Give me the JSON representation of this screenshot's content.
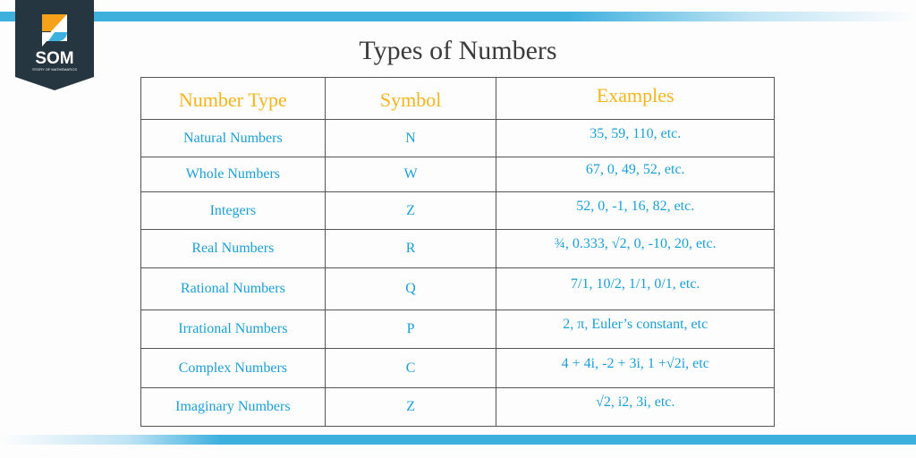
{
  "brand": {
    "logo_text": "SOM",
    "logo_subtext": "STORY OF MATHEMATICS"
  },
  "title": "Types of Numbers",
  "table": {
    "headers": [
      "Number Type",
      "Symbol",
      "Examples"
    ],
    "rows": [
      [
        "Natural Numbers",
        "N",
        "35, 59, 110, etc."
      ],
      [
        "Whole Numbers",
        "W",
        "67, 0, 49, 52, etc."
      ],
      [
        "Integers",
        "Z",
        "52, 0, -1, 16, 82, etc."
      ],
      [
        "Real Numbers",
        "R",
        "¾, 0.333, √2, 0, -10, 20, etc."
      ],
      [
        "Rational Numbers",
        "Q",
        "7/1, 10/2, 1/1, 0/1, etc."
      ],
      [
        "Irrational Numbers",
        "P",
        "2, π, Euler’s constant, etc"
      ],
      [
        "Complex Numbers",
        "C",
        "4 + 4i, -2 + 3i, 1 +√2i, etc"
      ],
      [
        "Imaginary Numbers",
        "Z",
        "√2, i2, 3i, etc."
      ]
    ]
  },
  "colors": {
    "header": "#f5b51a",
    "cell": "#1a9fd8",
    "accent": "#3eb0de",
    "logo_bg": "#263640"
  }
}
